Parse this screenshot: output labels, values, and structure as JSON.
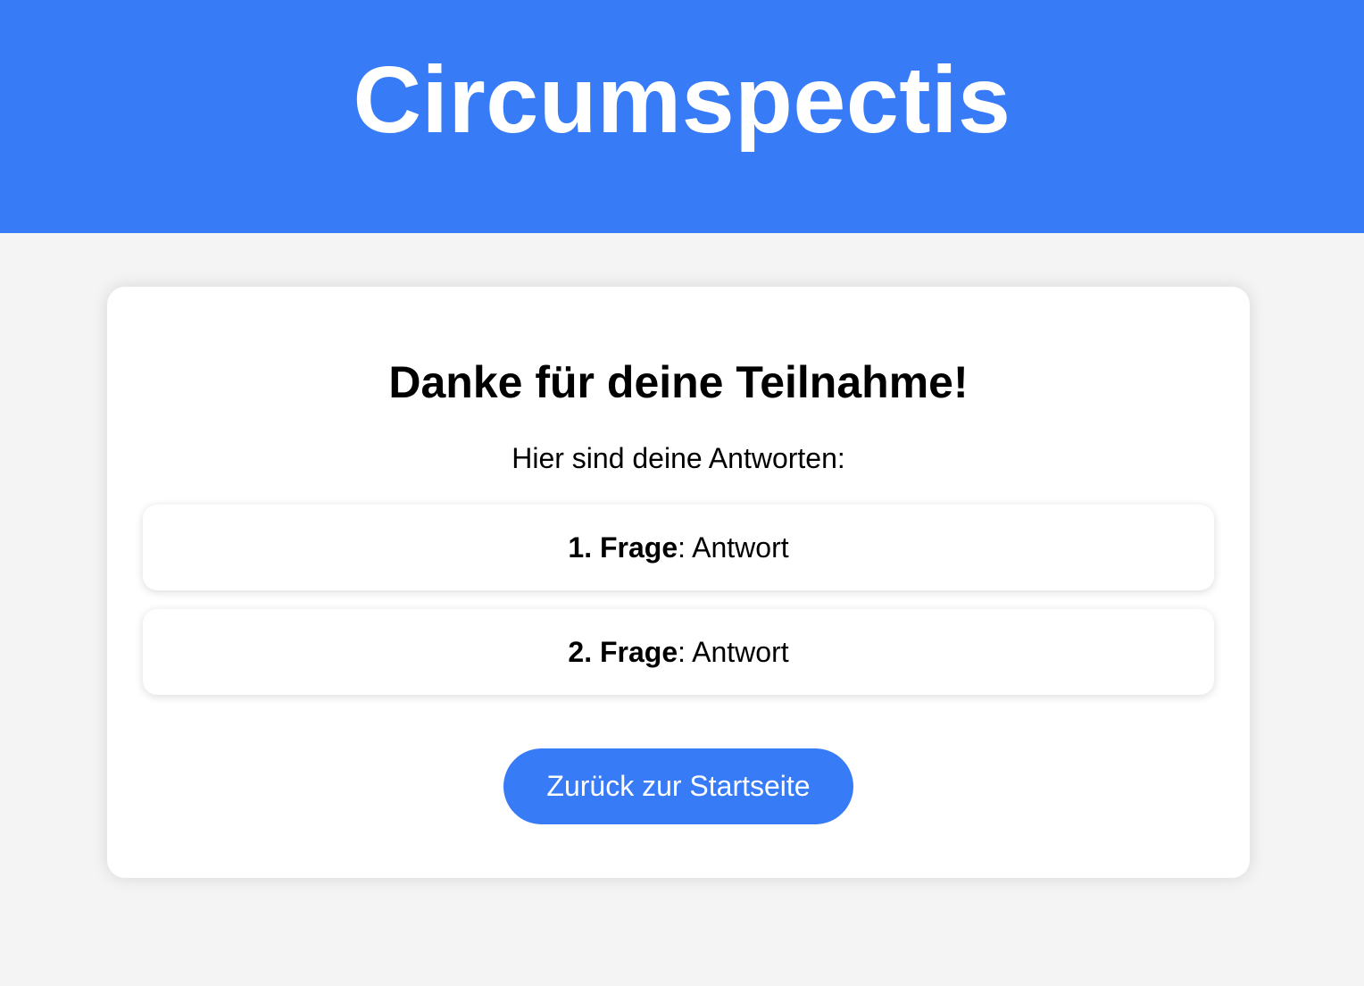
{
  "header": {
    "title": "Circumspectis",
    "background_color": "#387bf7"
  },
  "card": {
    "heading": "Danke für deine Teilnahme!",
    "intro": "Hier sind deine Antworten:",
    "answers": [
      {
        "question": "1. Frage",
        "separator": ":",
        "answer": " Antwort"
      },
      {
        "question": "2. Frage",
        "separator": ":",
        "answer": " Antwort"
      }
    ],
    "button_label": "Zurück zur Startseite"
  },
  "colors": {
    "accent": "#387bf7",
    "page_background": "#f4f4f4",
    "card_background": "#ffffff"
  }
}
